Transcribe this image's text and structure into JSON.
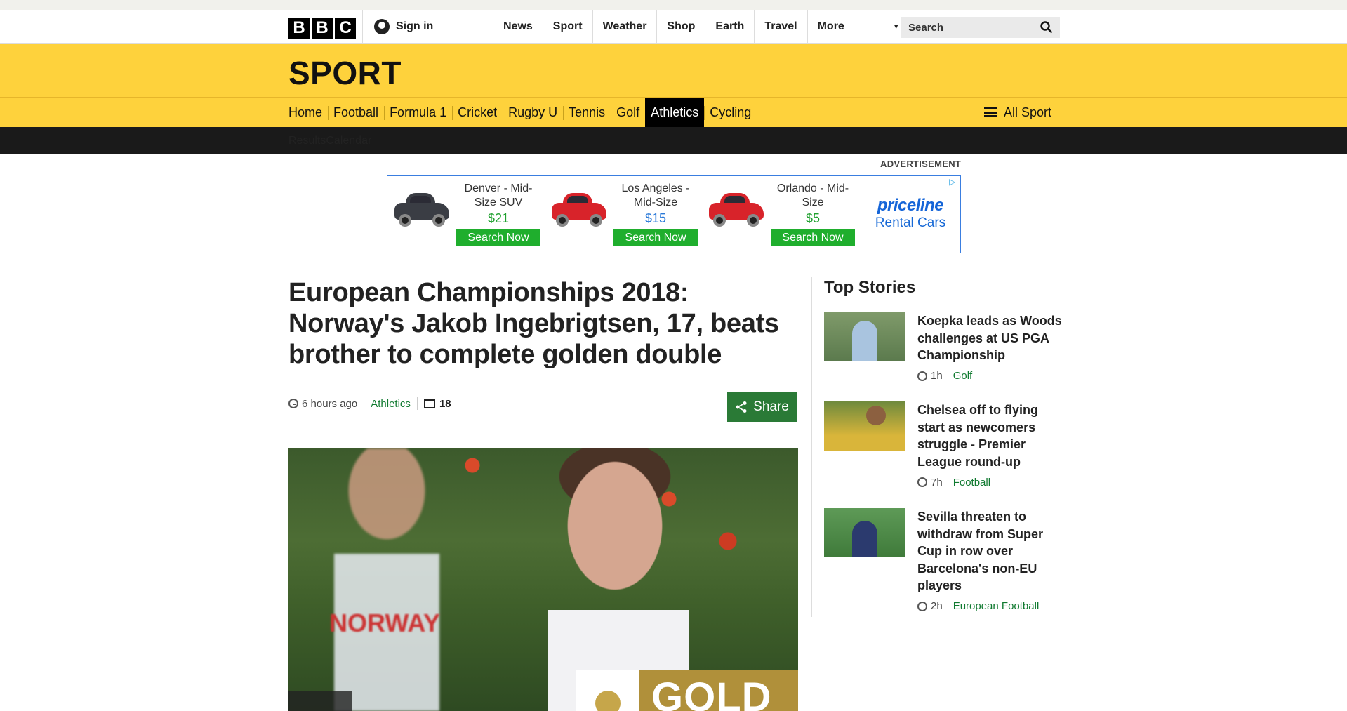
{
  "masthead": {
    "logo_letters": [
      "B",
      "B",
      "C"
    ],
    "sign_in": "Sign in",
    "nav": [
      "News",
      "Sport",
      "Weather",
      "Shop",
      "Earth",
      "Travel"
    ],
    "more": "More",
    "search_placeholder": "Search"
  },
  "sport": {
    "title": "SPORT",
    "nav": [
      "Home",
      "Football",
      "Formula 1",
      "Cricket",
      "Rugby U",
      "Tennis",
      "Golf",
      "Athletics",
      "Cycling"
    ],
    "active": "Athletics",
    "all_sport": "All Sport",
    "subnav": [
      "Results",
      "Calendar"
    ]
  },
  "ad": {
    "label": "ADVERTISEMENT",
    "offers": [
      {
        "name": "Denver - Mid-Size SUV",
        "price": "$21",
        "button": "Search Now",
        "car_color": "#3a3d44"
      },
      {
        "name": "Los Angeles - Mid-Size",
        "price": "$15",
        "button": "Search Now",
        "car_color": "#d8232a"
      },
      {
        "name": "Orlando - Mid-Size",
        "price": "$5",
        "button": "Search Now",
        "car_color": "#d8232a"
      }
    ],
    "brand": "priceline",
    "brand_sub": "Rental Cars"
  },
  "article": {
    "headline": "European Championships 2018: Norway's Jakob Ingebrigtsen, 17, beats brother to complete golden double",
    "time": "6 hours ago",
    "section": "Athletics",
    "comments": "18",
    "share": "Share",
    "hero_badge": "GOLD",
    "hero_shirt_text": "NORWAY"
  },
  "top_stories": {
    "title": "Top Stories",
    "items": [
      {
        "headline": "Koepka leads as Woods challenges at US PGA Championship",
        "time": "1h",
        "section": "Golf"
      },
      {
        "headline": "Chelsea off to flying start as newcomers struggle - Premier League round-up",
        "time": "7h",
        "section": "Football"
      },
      {
        "headline": "Sevilla threaten to withdraw from Super Cup in row over Barcelona's non-EU players",
        "time": "2h",
        "section": "European Football"
      }
    ]
  },
  "colors": {
    "sport_yellow": "#fed23c",
    "section_green": "#107a30",
    "share_green": "#2a7a36",
    "ad_price_green": "#1fa02e",
    "ad_button_green": "#1fae2d",
    "priceline_blue": "#1565d8"
  }
}
